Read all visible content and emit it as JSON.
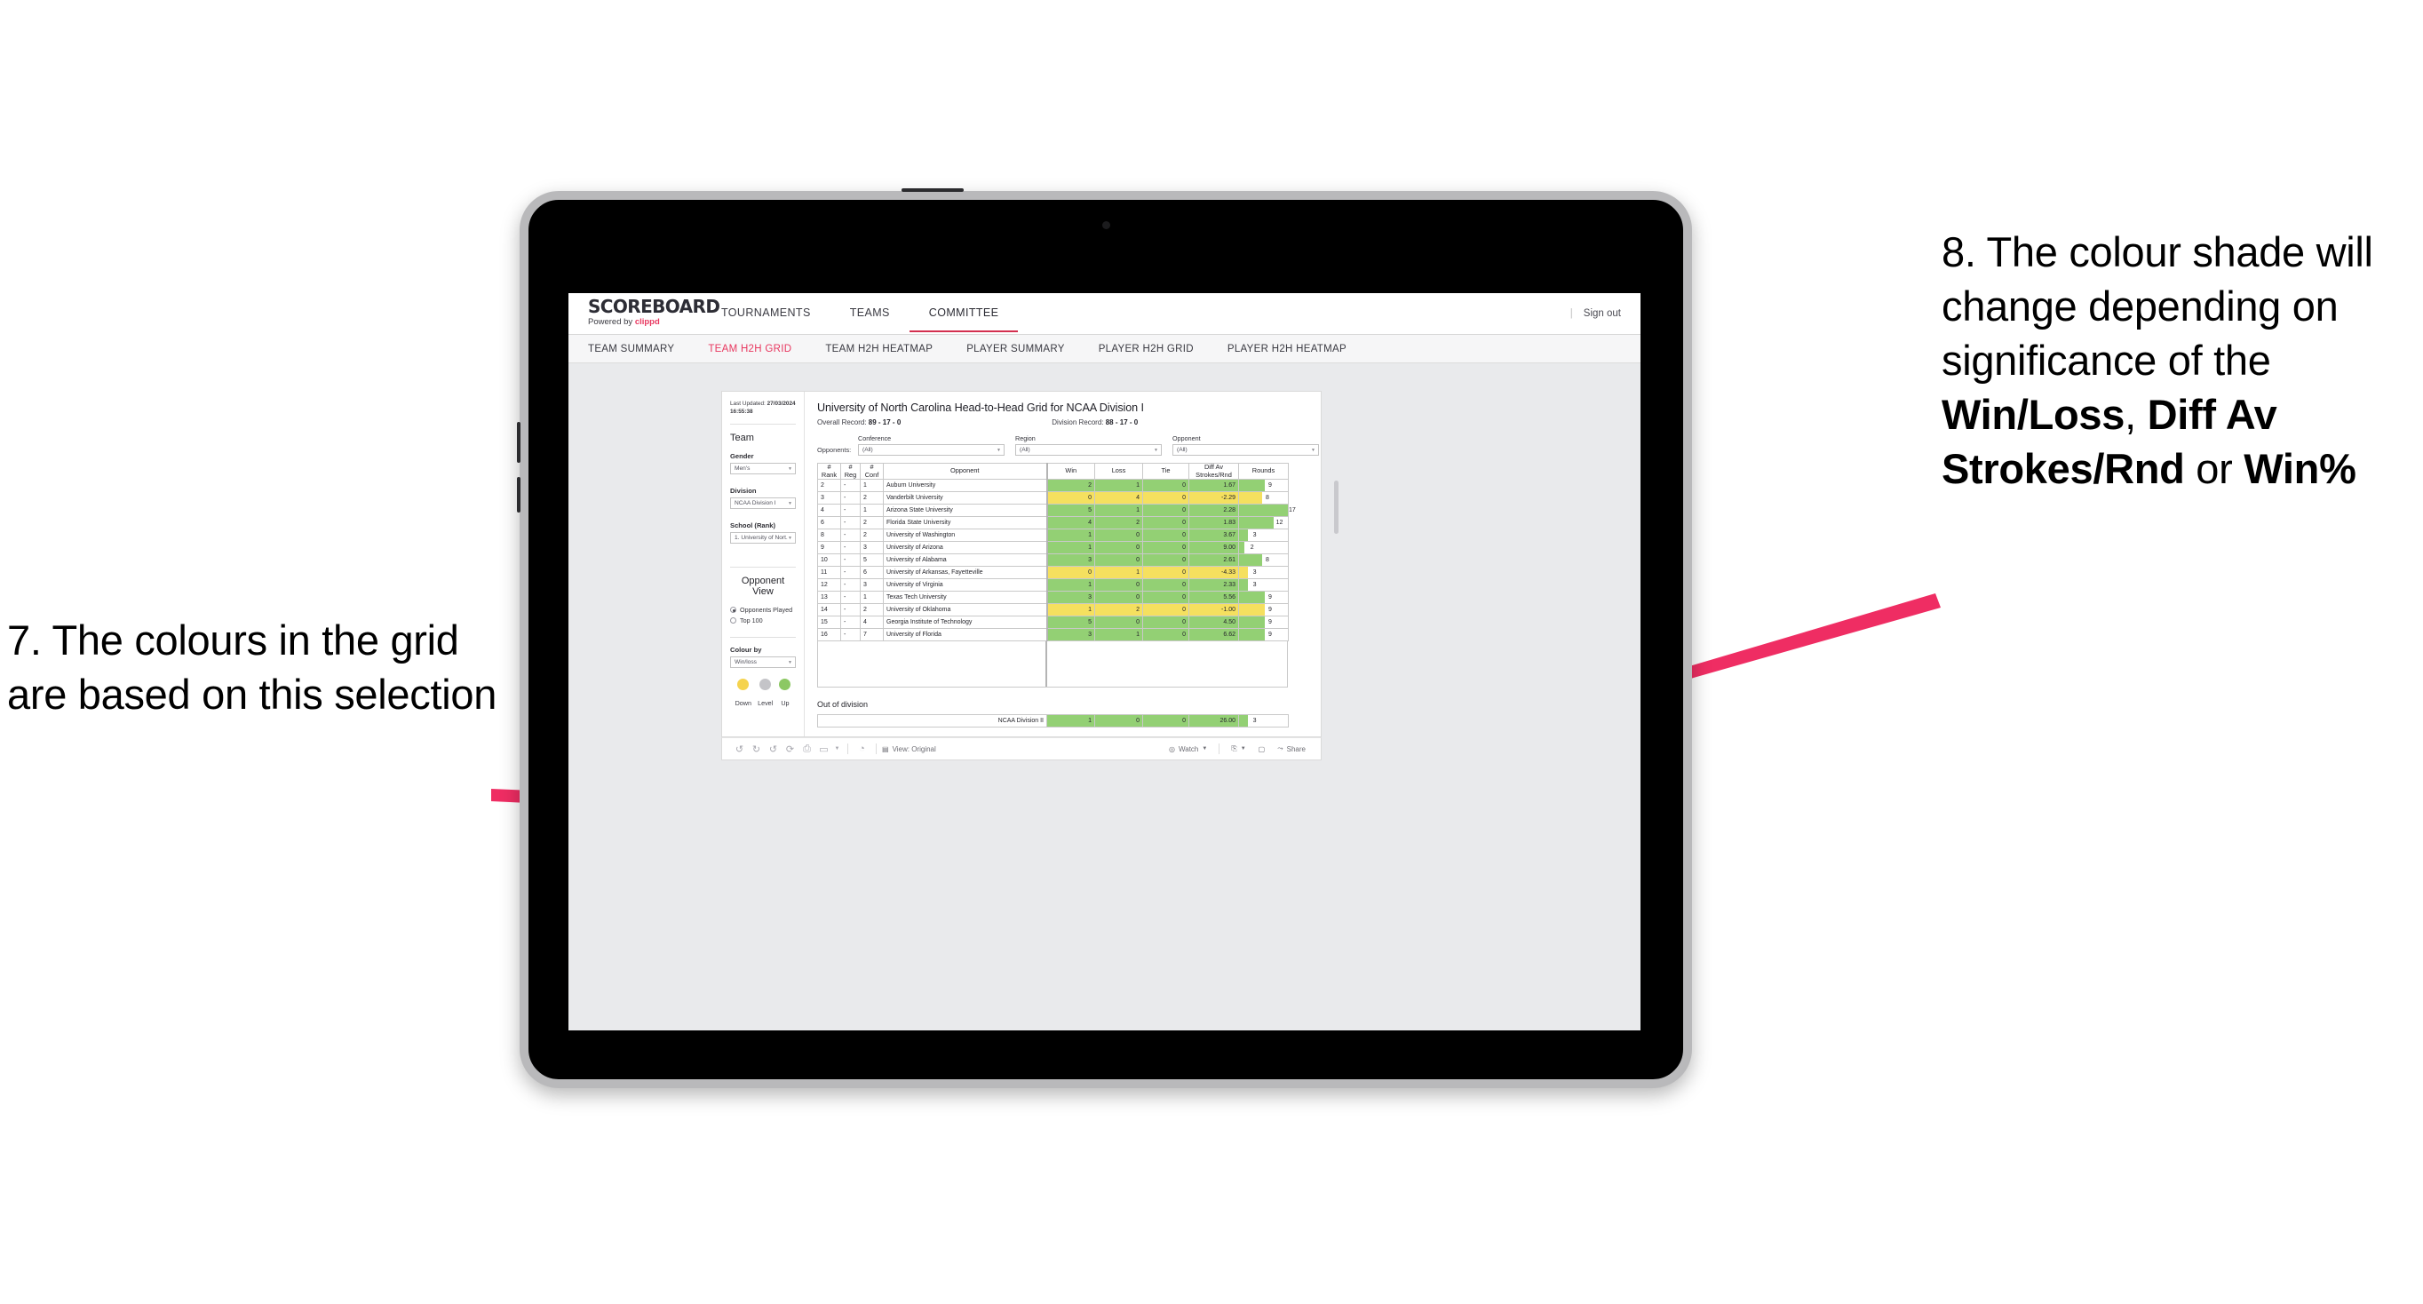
{
  "annotations": {
    "left": "7. The colours in the grid are based on this selection",
    "right_parts": [
      {
        "text": "8. The colour shade will change depending on significance of the ",
        "bold": false
      },
      {
        "text": "Win/Loss",
        "bold": true
      },
      {
        "text": ", ",
        "bold": false
      },
      {
        "text": "Diff Av Strokes/Rnd",
        "bold": true
      },
      {
        "text": " or ",
        "bold": false
      },
      {
        "text": "Win%",
        "bold": true
      }
    ],
    "arrow_color": "#ef2d63"
  },
  "app": {
    "brand_title": "SCOREBOARD",
    "brand_sub_prefix": "Powered by ",
    "brand_sub_link": "clippd",
    "nav_tabs": [
      {
        "label": "TOURNAMENTS",
        "active": false
      },
      {
        "label": "TEAMS",
        "active": false
      },
      {
        "label": "COMMITTEE",
        "active": true
      }
    ],
    "sign_out": "Sign out",
    "sub_tabs": [
      {
        "label": "TEAM SUMMARY",
        "active": false
      },
      {
        "label": "TEAM H2H GRID",
        "active": true
      },
      {
        "label": "TEAM H2H HEATMAP",
        "active": false
      },
      {
        "label": "PLAYER SUMMARY",
        "active": false
      },
      {
        "label": "PLAYER H2H GRID",
        "active": false
      },
      {
        "label": "PLAYER H2H HEATMAP",
        "active": false
      }
    ],
    "accent_pink": "#e8375f"
  },
  "filters": {
    "last_updated_label": "Last Updated: ",
    "last_updated_value": "27/03/2024 16:55:38",
    "team_heading": "Team",
    "gender_label": "Gender",
    "gender_value": "Men's",
    "division_label": "Division",
    "division_value": "NCAA Division I",
    "school_label": "School (Rank)",
    "school_value": "1. University of Nort...",
    "opponent_view_heading": "Opponent View",
    "opponent_view_options": [
      {
        "label": "Opponents Played",
        "selected": true
      },
      {
        "label": "Top 100",
        "selected": false
      }
    ],
    "colour_by_label": "Colour by",
    "colour_by_value": "Win/loss",
    "legend": [
      {
        "label": "Down",
        "color": "#f5d34e"
      },
      {
        "label": "Level",
        "color": "#c4c4c8"
      },
      {
        "label": "Up",
        "color": "#8cc863"
      }
    ]
  },
  "report": {
    "title": "University of North Carolina Head-to-Head Grid for NCAA Division I",
    "overall_record_label": "Overall Record: ",
    "overall_record_value": "89 - 17 - 0",
    "division_record_label": "Division Record: ",
    "division_record_value": "88 - 17 - 0",
    "opponents_label": "Opponents:",
    "opponent_filters": [
      {
        "title": "Conference",
        "value": "(All)"
      },
      {
        "title": "Region",
        "value": "(All)"
      },
      {
        "title": "Opponent",
        "value": "(All)"
      }
    ]
  },
  "chart_data": {
    "type": "table",
    "title": "University of North Carolina Head-to-Head Grid for NCAA Division I",
    "columns": [
      "# Rank",
      "# Reg",
      "# Conf",
      "Opponent",
      "Win",
      "Loss",
      "Tie",
      "Diff Av Strokes/Rnd",
      "Rounds"
    ],
    "colour_by": "Win/loss",
    "colours": {
      "up": "#93d074",
      "down": "#f5e05f",
      "level": "#c4c4c8"
    },
    "rounds_max": 17,
    "rows": [
      {
        "rank": "2",
        "reg": "-",
        "conf": "1",
        "opponent": "Auburn University",
        "win": "2",
        "loss": "1",
        "tie": "0",
        "diff": "1.67",
        "rounds": "9",
        "shade": "up"
      },
      {
        "rank": "3",
        "reg": "-",
        "conf": "2",
        "opponent": "Vanderbilt University",
        "win": "0",
        "loss": "4",
        "tie": "0",
        "diff": "-2.29",
        "rounds": "8",
        "shade": "down"
      },
      {
        "rank": "4",
        "reg": "-",
        "conf": "1",
        "opponent": "Arizona State University",
        "win": "5",
        "loss": "1",
        "tie": "0",
        "diff": "2.28",
        "rounds": "17",
        "shade": "up"
      },
      {
        "rank": "6",
        "reg": "-",
        "conf": "2",
        "opponent": "Florida State University",
        "win": "4",
        "loss": "2",
        "tie": "0",
        "diff": "1.83",
        "rounds": "12",
        "shade": "up"
      },
      {
        "rank": "8",
        "reg": "-",
        "conf": "2",
        "opponent": "University of Washington",
        "win": "1",
        "loss": "0",
        "tie": "0",
        "diff": "3.67",
        "rounds": "3",
        "shade": "up"
      },
      {
        "rank": "9",
        "reg": "-",
        "conf": "3",
        "opponent": "University of Arizona",
        "win": "1",
        "loss": "0",
        "tie": "0",
        "diff": "9.00",
        "rounds": "2",
        "shade": "up"
      },
      {
        "rank": "10",
        "reg": "-",
        "conf": "5",
        "opponent": "University of Alabama",
        "win": "3",
        "loss": "0",
        "tie": "0",
        "diff": "2.61",
        "rounds": "8",
        "shade": "up"
      },
      {
        "rank": "11",
        "reg": "-",
        "conf": "6",
        "opponent": "University of Arkansas, Fayetteville",
        "win": "0",
        "loss": "1",
        "tie": "0",
        "diff": "-4.33",
        "rounds": "3",
        "shade": "down"
      },
      {
        "rank": "12",
        "reg": "-",
        "conf": "3",
        "opponent": "University of Virginia",
        "win": "1",
        "loss": "0",
        "tie": "0",
        "diff": "2.33",
        "rounds": "3",
        "shade": "up"
      },
      {
        "rank": "13",
        "reg": "-",
        "conf": "1",
        "opponent": "Texas Tech University",
        "win": "3",
        "loss": "0",
        "tie": "0",
        "diff": "5.56",
        "rounds": "9",
        "shade": "up"
      },
      {
        "rank": "14",
        "reg": "-",
        "conf": "2",
        "opponent": "University of Oklahoma",
        "win": "1",
        "loss": "2",
        "tie": "0",
        "diff": "-1.00",
        "rounds": "9",
        "shade": "down"
      },
      {
        "rank": "15",
        "reg": "-",
        "conf": "4",
        "opponent": "Georgia Institute of Technology",
        "win": "5",
        "loss": "0",
        "tie": "0",
        "diff": "4.50",
        "rounds": "9",
        "shade": "up"
      },
      {
        "rank": "16",
        "reg": "-",
        "conf": "7",
        "opponent": "University of Florida",
        "win": "3",
        "loss": "1",
        "tie": "0",
        "diff": "6.62",
        "rounds": "9",
        "shade": "up"
      }
    ],
    "out_of_division": {
      "title": "Out of division",
      "rows": [
        {
          "opponent": "NCAA Division II",
          "win": "1",
          "loss": "0",
          "tie": "0",
          "diff": "26.00",
          "rounds": "3",
          "shade": "up"
        }
      ]
    }
  },
  "toolbar": {
    "icons": [
      "undo-icon",
      "redo-icon",
      "revert-icon",
      "refresh-icon",
      "pause-icon",
      "alerts-icon",
      "dropdown-caret"
    ],
    "view_label": "View: Original",
    "watch_label": "Watch",
    "share_label": "Share"
  }
}
